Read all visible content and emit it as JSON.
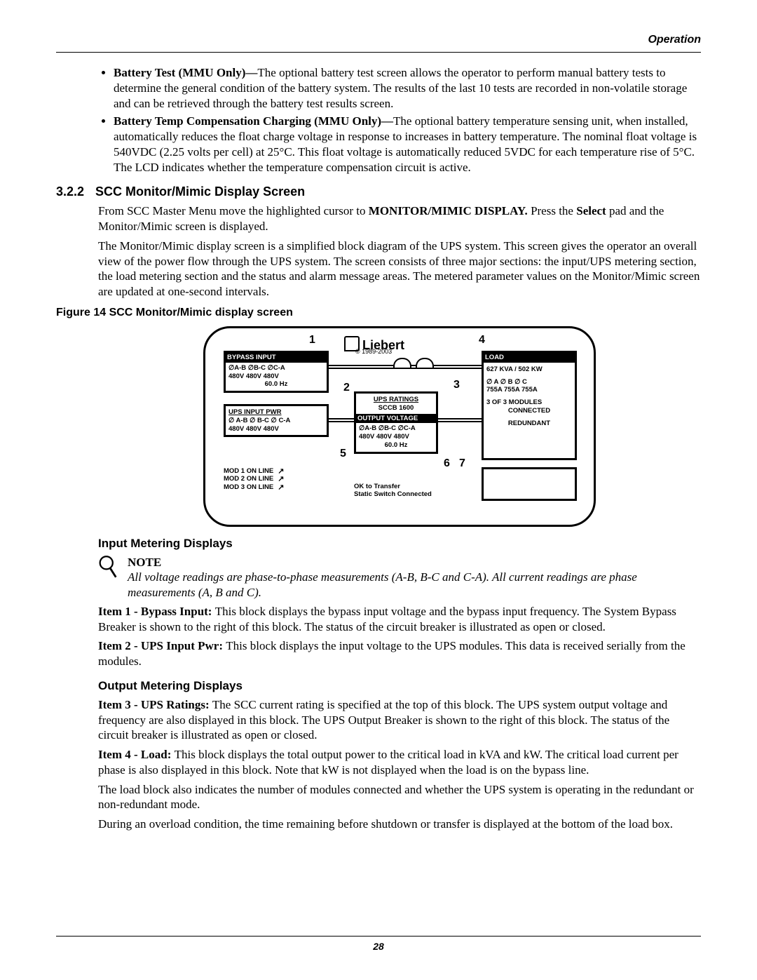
{
  "header": {
    "section": "Operation"
  },
  "footer": {
    "page": "28"
  },
  "bullets": {
    "b1_lead": "Battery Test (MMU Only)—",
    "b1_body": "The optional battery test screen allows the operator to perform manual battery tests to determine the general condition of the battery system. The results of the last 10 tests are recorded in non-volatile storage and can be retrieved through the battery test results screen.",
    "b2_lead": "Battery Temp Compensation Charging (MMU Only)—",
    "b2_body": "The optional battery temperature sensing unit, when installed, automatically reduces the float charge voltage in response to increases in battery temperature. The nominal float voltage is 540VDC (2.25 volts per cell) at 25°C. This float voltage is automatically reduced 5VDC for each temperature rise of 5°C. The LCD indicates whether the temperature compensation circuit is active."
  },
  "sec": {
    "num": "3.2.2",
    "title": "SCC Monitor/Mimic Display Screen"
  },
  "p1a": "From SCC Master Menu move the highlighted cursor to ",
  "p1b": "MONITOR/MIMIC DISPLAY.",
  "p1c": " Press the ",
  "p1d": "Select",
  "p1e": " pad and the Monitor/Mimic screen is displayed.",
  "p2": "The Monitor/Mimic display screen is a simplified block diagram of the UPS system. This screen gives the operator an overall view of the power flow through the UPS system. The screen consists of three major sections: the input/UPS metering section, the load metering section and the status and alarm message areas. The metered parameter values on the Monitor/Mimic screen are updated at one-second intervals.",
  "figcap": "Figure 14  SCC Monitor/Mimic display screen",
  "diagram": {
    "brand": "Liebert",
    "copyright": "© 1989-2003",
    "nums": {
      "n1": "1",
      "n2": "2",
      "n3": "3",
      "n4": "4",
      "n5": "5",
      "n6": "6",
      "n7": "7"
    },
    "bypass": {
      "t": "BYPASS INPUT",
      "ph": "∅A-B  ∅B-C  ∅C-A",
      "v": "480V  480V  480V",
      "hz": "60.0 Hz"
    },
    "upsin": {
      "t": "UPS INPUT PWR",
      "ph": "∅ A-B  ∅ B-C  ∅ C-A",
      "v": "480V  480V  480V"
    },
    "ratings": {
      "t": "UPS RATINGS",
      "model": "SCCB 1600",
      "ov": "OUTPUT VOLTAGE",
      "ph": "∅A-B ∅B-C ∅C-A",
      "v": "480V  480V  480V",
      "hz": "60.0 Hz"
    },
    "load": {
      "t": "LOAD",
      "pwr": "627 KVA / 502 KW",
      "ph": "∅ A    ∅ B    ∅ C",
      "amps": "755A  755A  755A",
      "mods": "3 OF 3 MODULES",
      "conn": "CONNECTED",
      "red": "REDUNDANT"
    },
    "mods": {
      "m1": "MOD 1  ON LINE",
      "m2": "MOD 2  ON LINE",
      "m3": "MOD 3  ON LINE"
    },
    "status": {
      "ok": "OK to Transfer",
      "sw": "Static Switch Connected"
    }
  },
  "h_input": "Input Metering Displays",
  "note": {
    "label": "NOTE",
    "body": "All voltage readings are phase-to-phase measurements (A-B, B-C and C-A). All current readings are phase measurements (A, B and C)."
  },
  "item1_lead": "Item 1 - Bypass Input: ",
  "item1_body": "This block displays the bypass input voltage and the bypass input frequency. The System Bypass Breaker is shown to the right of this block. The status of the circuit breaker is illustrated as open or closed.",
  "item2_lead": "Item 2 - UPS Input Pwr: ",
  "item2_body": "This block displays the input voltage to the UPS modules. This data is received serially from the modules.",
  "h_output": "Output Metering Displays",
  "item3_lead": "Item 3 - UPS Ratings: ",
  "item3_body": "The SCC current rating is specified at the top of this block. The UPS system output voltage and frequency are also displayed in this block. The UPS Output Breaker is shown to the right of this block. The status of the circuit breaker is illustrated as open or closed.",
  "item4_lead": "Item 4 - Load: ",
  "item4_body": "This block displays the total output power to the critical load in kVA and kW. The critical load current per phase is also displayed in this block. Note that kW is not displayed when the load is on the bypass line.",
  "p_load2": "The load block also indicates the number of modules connected and whether the UPS system is operating in the redundant or non-redundant mode.",
  "p_load3": "During an overload condition, the time remaining before shutdown or transfer is displayed at the bottom of the load box."
}
